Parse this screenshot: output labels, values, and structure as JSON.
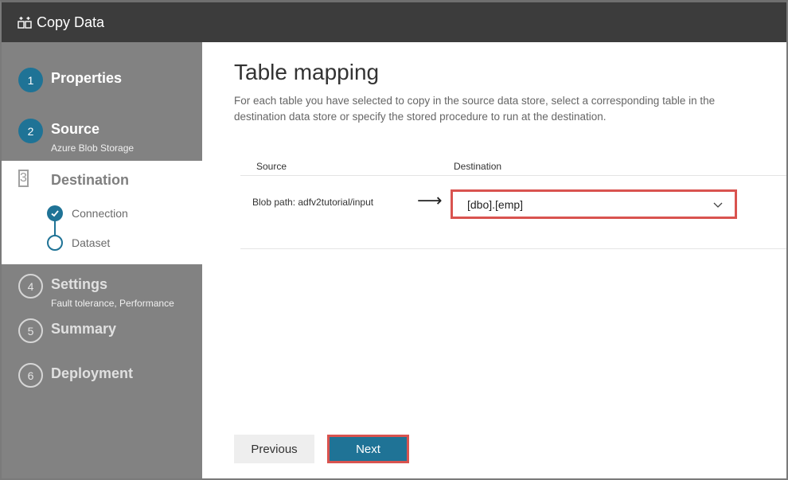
{
  "window": {
    "title": "Copy Data",
    "icon": "copy-data-icon"
  },
  "steps": [
    {
      "number": "1",
      "label": "Properties",
      "sub": ""
    },
    {
      "number": "2",
      "label": "Source",
      "sub": "Azure Blob Storage"
    },
    {
      "number": "3",
      "label": "Destination",
      "sub": ""
    },
    {
      "number": "4",
      "label": "Settings",
      "sub": "Fault tolerance, Performance"
    },
    {
      "number": "5",
      "label": "Summary",
      "sub": ""
    },
    {
      "number": "6",
      "label": "Deployment",
      "sub": ""
    }
  ],
  "substeps": [
    {
      "label": "Connection",
      "state": "done"
    },
    {
      "label": "Dataset",
      "state": "current"
    }
  ],
  "main": {
    "title": "Table mapping",
    "description": "For each table you have selected to copy in the source data store, select a corresponding table in the destination data store or specify the stored procedure to run at the destination.",
    "columns": {
      "source": "Source",
      "destination": "Destination"
    },
    "rows": [
      {
        "source": "Blob path: adfv2tutorial/input",
        "arrow": "⟶",
        "destination": "[dbo].[emp]"
      }
    ]
  },
  "buttons": {
    "previous": "Previous",
    "next": "Next"
  },
  "colors": {
    "accent": "#1f7396",
    "sidebar": "#828282",
    "titlebar": "#3c3c3c",
    "highlight": "#d9534f"
  }
}
